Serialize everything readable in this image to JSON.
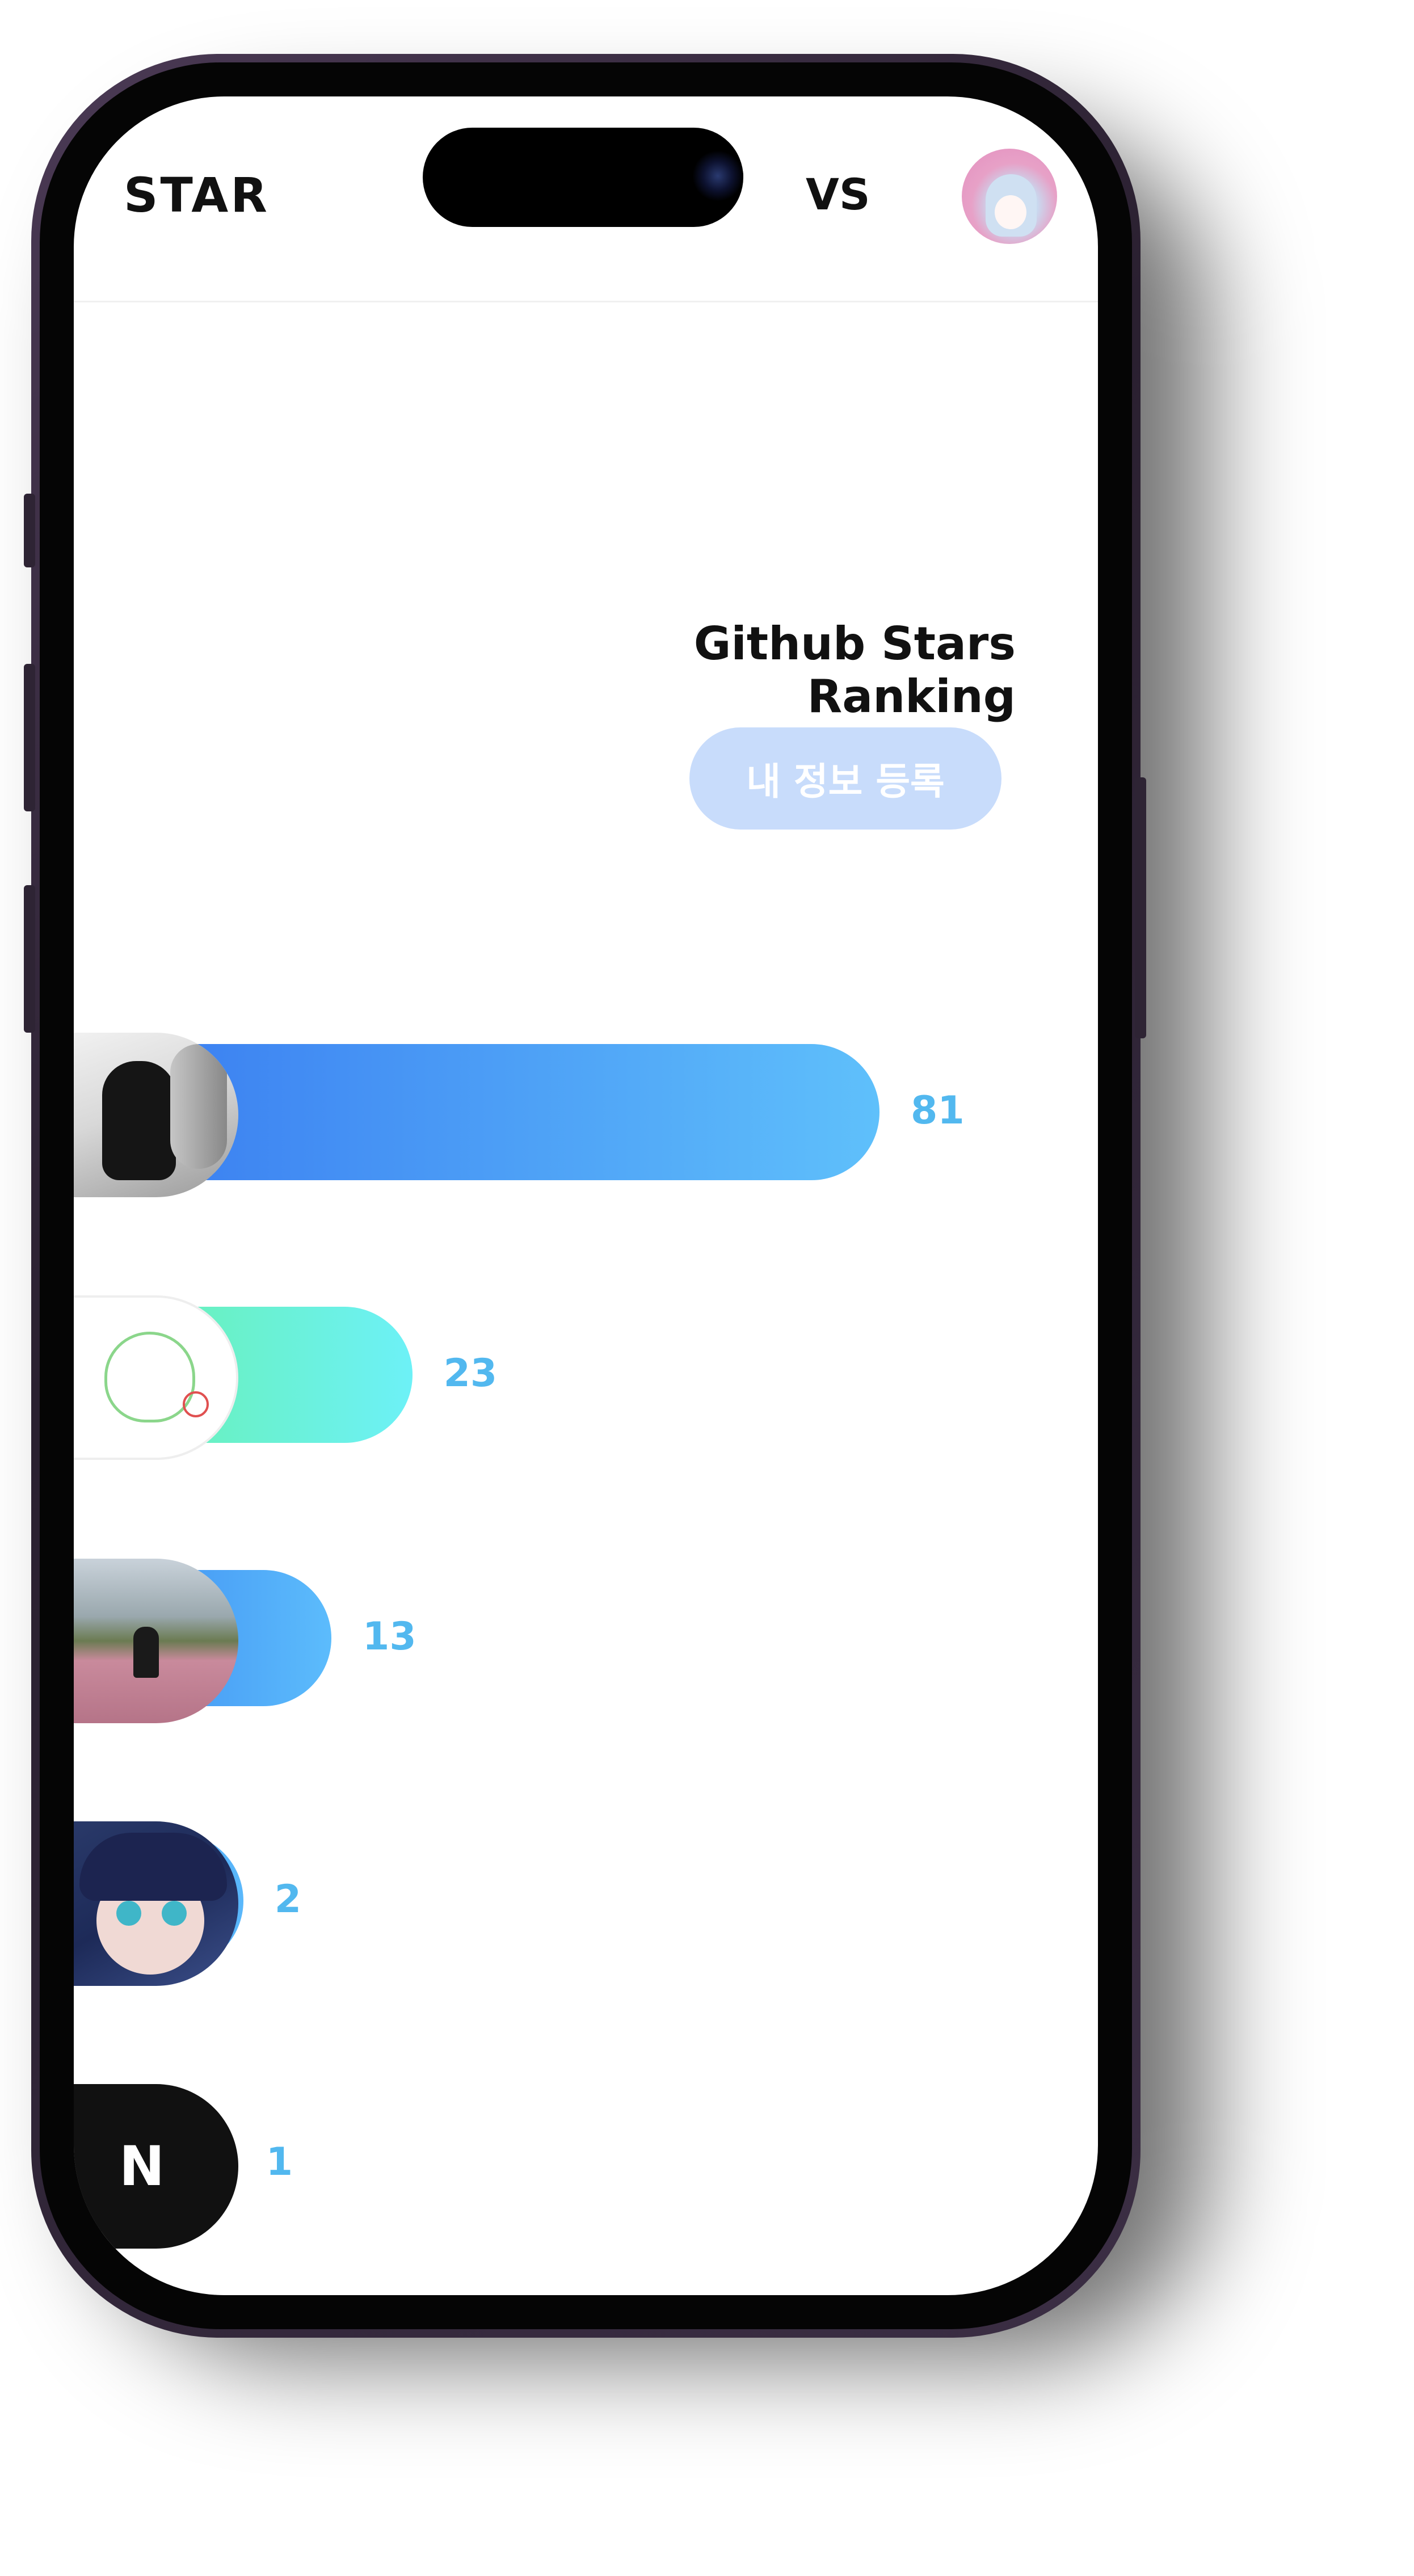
{
  "header": {
    "logo": "STAR",
    "vs_label": "VS",
    "avatar_icon": "user-avatar"
  },
  "main": {
    "title": "Github Stars Ranking",
    "register_button": "내 정보 등록"
  },
  "ranking": [
    {
      "stars": "81",
      "bar_fraction": 1.0,
      "color_from": "#3778f0",
      "color_to": "#5fc0fb",
      "avatar": "monochrome-photo-avatar"
    },
    {
      "stars": "23",
      "bar_fraction": 0.284,
      "color_from": "#66f1a4",
      "color_to": "#6df1f7",
      "avatar": "cat-sketch-avatar"
    },
    {
      "stars": "13",
      "bar_fraction": 0.16,
      "color_from": "#3a86f0",
      "color_to": "#5cbcfc",
      "avatar": "field-photo-avatar"
    },
    {
      "stars": "2",
      "bar_fraction": 0.025,
      "color_from": "#3d8bf0",
      "color_to": "#5ab8fb",
      "avatar": "anime-girl-avatar"
    },
    {
      "stars": "1",
      "bar_fraction": 0.012,
      "color_from": "#111111",
      "color_to": "#111111",
      "avatar": "logo-avatar"
    }
  ],
  "colors": {
    "accent": "#52b8ef",
    "button_bg": "#c8dcfb"
  }
}
